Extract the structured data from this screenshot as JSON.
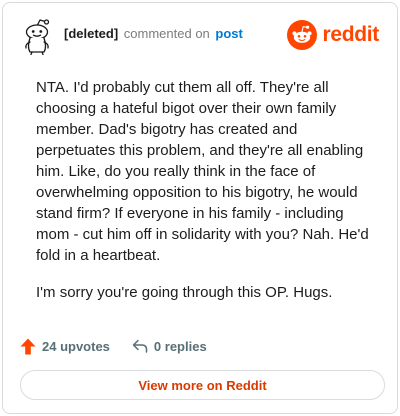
{
  "header": {
    "username": "[deleted]",
    "action_text": "commented on",
    "post_link_text": "post",
    "brand_text": "reddit"
  },
  "comment": {
    "paragraphs": [
      "NTA. I'd probably cut them all off. They're all choosing a hateful bigot over their own family member. Dad's bigotry has created and perpetuates this problem, and they're all enabling him. Like, do you really think in the face of overwhelming opposition to his bigotry, he would stand firm? If everyone in his family - including mom - cut him off in solidarity with you? Nah. He'd fold in a heartbeat.",
      "I'm sorry you're going through this OP. Hugs."
    ]
  },
  "actions": {
    "upvotes_text": "24 upvotes",
    "replies_text": "0 replies"
  },
  "footer": {
    "view_more_label": "View more on Reddit"
  },
  "colors": {
    "brand": "#ff4500",
    "upvote_arrow": "#ff4500",
    "link_blue": "#0079d3",
    "view_more_text": "#d93a00"
  },
  "icons": {
    "avatar": "deleted-user-snoo-avatar",
    "brand": "reddit-snoo-logo",
    "upvote": "upvote-arrow-icon",
    "reply": "reply-arrow-icon"
  }
}
